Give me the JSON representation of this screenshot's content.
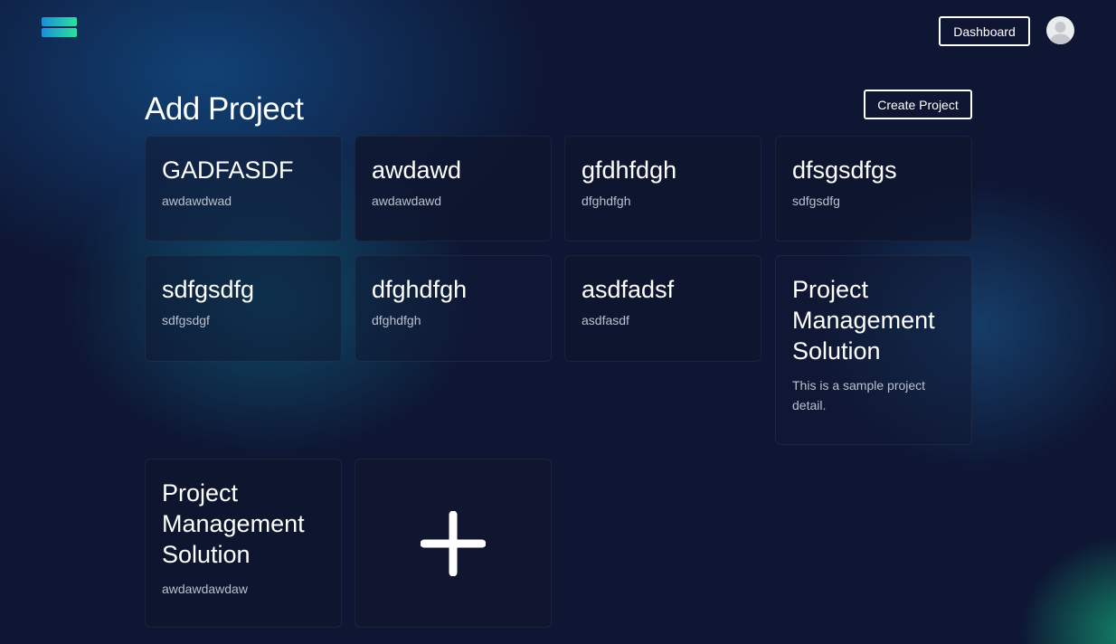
{
  "header": {
    "logo_icon": "stacked-bars-logo-icon",
    "dashboard_label": "Dashboard",
    "avatar_icon": "user-avatar-icon"
  },
  "page": {
    "title": "Add Project",
    "create_label": "Create Project"
  },
  "projects": [
    {
      "title": "GADFASDF",
      "description": "awdawdwad"
    },
    {
      "title": "awdawd",
      "description": "awdawdawd"
    },
    {
      "title": "gfdhfdgh",
      "description": "dfghdfgh"
    },
    {
      "title": "dfsgsdfgs",
      "description": "sdfgsdfg"
    },
    {
      "title": "sdfgsdfg",
      "description": "sdfgsdgf"
    },
    {
      "title": "dfghdfgh",
      "description": "dfghdfgh"
    },
    {
      "title": "asdfadsf",
      "description": "asdfasdf"
    },
    {
      "title": "Project Management Solution",
      "description": "This is a sample project detail."
    },
    {
      "title": "Project Management Solution",
      "description": "awdawdawdaw"
    }
  ],
  "add_card": {
    "icon": "plus-icon"
  },
  "colors": {
    "background": "#0e1633",
    "accent_blue": "#1b8fd8",
    "accent_green": "#2de0a0",
    "text": "#ffffff",
    "muted_text": "#b9c0cf"
  }
}
